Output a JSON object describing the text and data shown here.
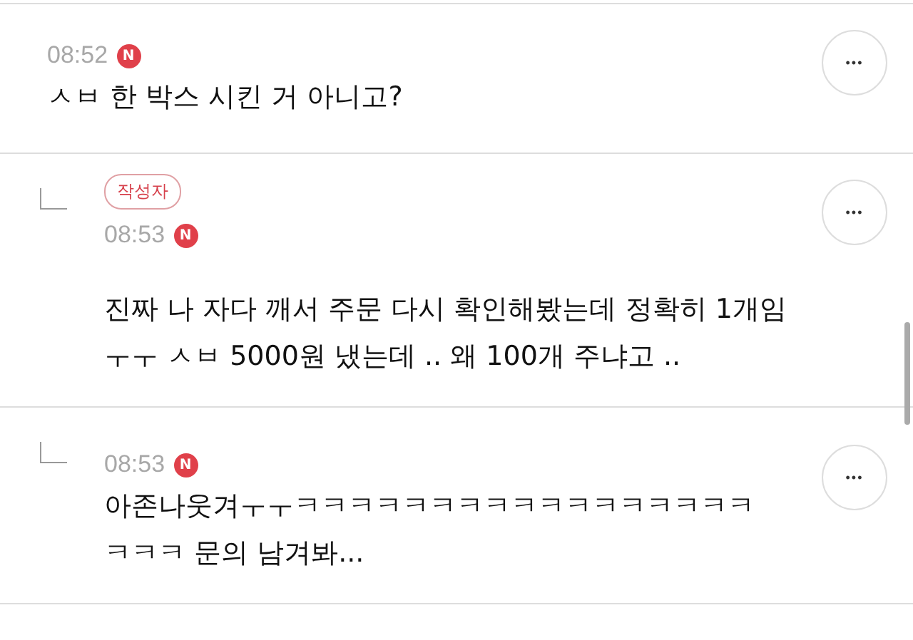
{
  "comments": [
    {
      "is_reply": false,
      "time": "08:52",
      "new_badge": "N",
      "lines": [
        "ㅅㅂ 한 박스 시킨 거 아니고?"
      ],
      "more_button": "•••"
    },
    {
      "is_reply": true,
      "author_badge": "작성자",
      "time": "08:53",
      "new_badge": "N",
      "lines": [
        "진짜 나 자다 깨서 주문 다시 확인해봤는데 정확히 1개임",
        "ㅜㅜ ㅅㅂ 5000원 냈는데 .. 왜 100개 주냐고 .."
      ],
      "more_button": "•••"
    },
    {
      "is_reply": true,
      "time": "08:53",
      "new_badge": "N",
      "lines": [
        "아존나웃겨ㅜㅜㅋㅋㅋㅋㅋㅋㅋㅋㅋㅋㅋㅋㅋㅋㅋㅋㅋ",
        "ㅋㅋㅋ 문의 남겨봐..."
      ],
      "more_button": "•••"
    }
  ]
}
